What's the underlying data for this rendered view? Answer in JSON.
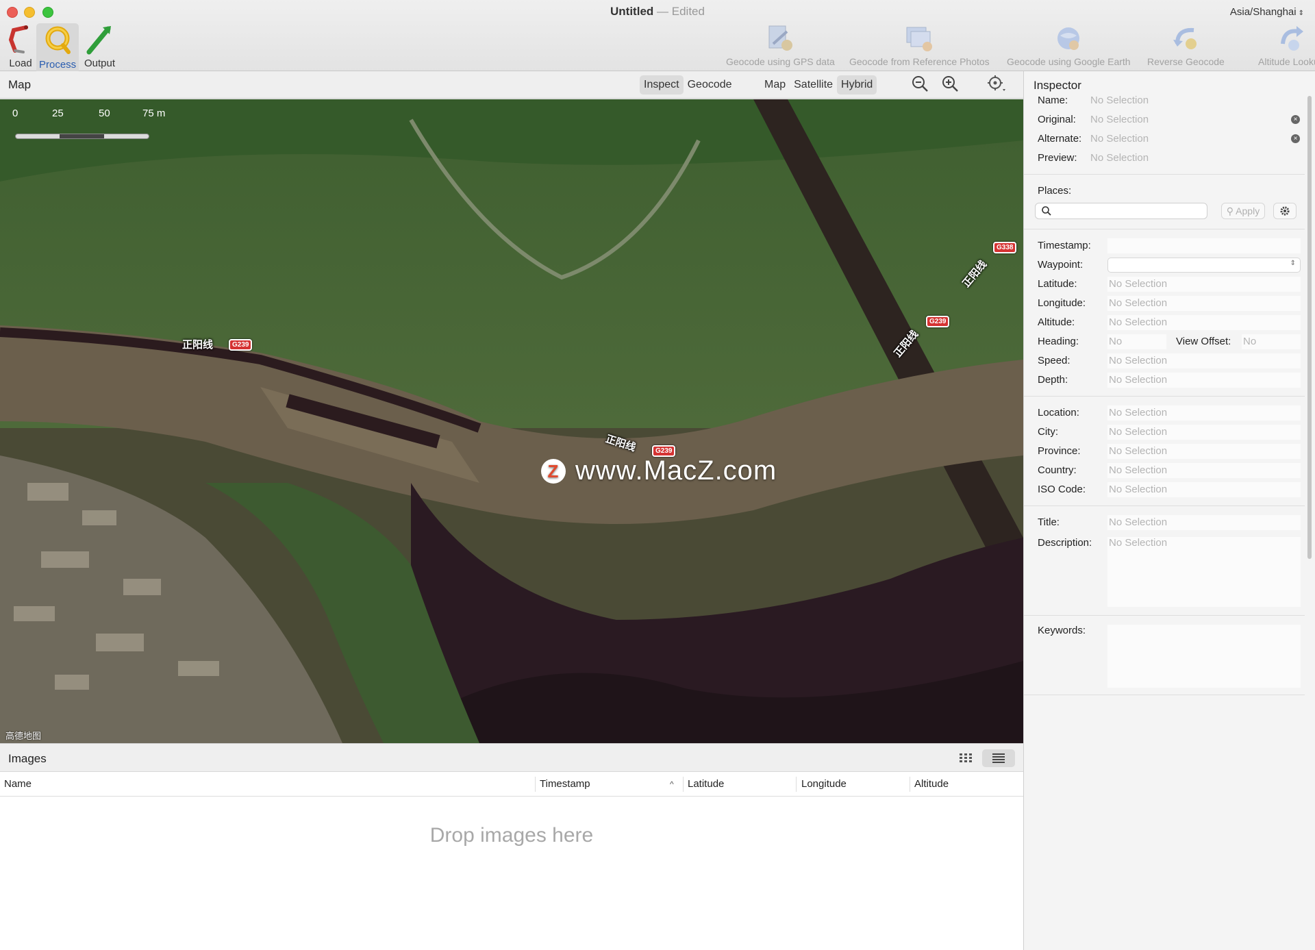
{
  "window": {
    "title": "Untitled",
    "separator": "—",
    "edited": "Edited",
    "timezone": "Asia/Shanghai"
  },
  "toolbar": {
    "left": [
      {
        "label": "Load",
        "icon": "load-icon"
      },
      {
        "label": "Process",
        "icon": "process-icon",
        "selected": true
      },
      {
        "label": "Output",
        "icon": "output-icon"
      }
    ],
    "right": [
      {
        "label": "Geocode using GPS data",
        "icon": "gps-geocode-icon",
        "enabled": false
      },
      {
        "label": "Geocode from Reference Photos",
        "icon": "reference-photos-icon",
        "enabled": false
      },
      {
        "label": "Geocode using Google Earth",
        "icon": "google-earth-icon",
        "enabled": false
      },
      {
        "label": "Reverse Geocode",
        "icon": "reverse-geocode-icon",
        "enabled": false
      },
      {
        "label": "Altitude Lookup",
        "icon": "altitude-lookup-icon",
        "enabled": false
      }
    ]
  },
  "map_panel": {
    "title": "Map",
    "mode_tabs": [
      "Inspect",
      "Geocode"
    ],
    "mode_selected": "Inspect",
    "type_tabs": [
      "Map",
      "Satellite",
      "Hybrid"
    ],
    "type_selected": "Hybrid",
    "scale_labels": [
      "0",
      "25",
      "50",
      "75 m"
    ],
    "road_labels": [
      "正阳线",
      "正阳线",
      "正阳线",
      "正阳线"
    ],
    "road_shields": [
      "G239",
      "G239",
      "G239",
      "G338"
    ],
    "watermark": "www.MacZ.com",
    "watermark_logo": "Z",
    "attribution": "高德地图"
  },
  "images_panel": {
    "title": "Images",
    "columns": [
      "Name",
      "Timestamp",
      "Latitude",
      "Longitude",
      "Altitude"
    ],
    "sort_column": "Timestamp",
    "sort_glyph": "^",
    "empty_hint": "Drop images here"
  },
  "inspector": {
    "title": "Inspector",
    "files": [
      {
        "label": "Name:",
        "value": "No Selection"
      },
      {
        "label": "Original:",
        "value": "No Selection"
      },
      {
        "label": "Alternate:",
        "value": "No Selection"
      },
      {
        "label": "Preview:",
        "value": "No Selection"
      }
    ],
    "places_label": "Places:",
    "places_search_placeholder": "",
    "apply_label": "Apply",
    "timestamp_label": "Timestamp:",
    "waypoint_label": "Waypoint:",
    "latitude": {
      "label": "Latitude:",
      "value": "No Selection"
    },
    "longitude": {
      "label": "Longitude:",
      "value": "No Selection"
    },
    "altitude": {
      "label": "Altitude:",
      "value": "No Selection"
    },
    "heading": {
      "label": "Heading:",
      "value": "No"
    },
    "view_offset": {
      "label": "View Offset:",
      "value": "No"
    },
    "speed": {
      "label": "Speed:",
      "value": "No Selection"
    },
    "depth": {
      "label": "Depth:",
      "value": "No Selection"
    },
    "location": {
      "label": "Location:",
      "value": "No Selection"
    },
    "city": {
      "label": "City:",
      "value": "No Selection"
    },
    "province": {
      "label": "Province:",
      "value": "No Selection"
    },
    "country": {
      "label": "Country:",
      "value": "No Selection"
    },
    "iso_code": {
      "label": "ISO Code:",
      "value": "No Selection"
    },
    "title_field": {
      "label": "Title:",
      "value": "No Selection"
    },
    "description": {
      "label": "Description:",
      "value": "No Selection"
    },
    "keywords_label": "Keywords:"
  }
}
